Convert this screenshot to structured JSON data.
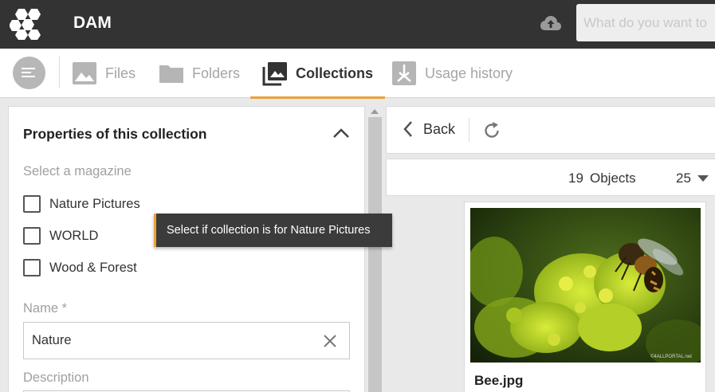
{
  "header": {
    "app_title": "DAM",
    "search_placeholder": "What do you want to"
  },
  "tabs": [
    {
      "label": "Files",
      "icon": "image-icon",
      "active": false
    },
    {
      "label": "Folders",
      "icon": "folder-icon",
      "active": false
    },
    {
      "label": "Collections",
      "icon": "collections-icon",
      "active": true
    },
    {
      "label": "Usage history",
      "icon": "usage-history-icon",
      "active": false
    }
  ],
  "properties": {
    "title": "Properties of this collection",
    "magazine_label": "Select a magazine",
    "magazines": [
      {
        "label": "Nature Pictures",
        "checked": false
      },
      {
        "label": "WORLD",
        "checked": false
      },
      {
        "label": "Wood & Forest",
        "checked": false
      }
    ],
    "name_label": "Name *",
    "name_value": "Nature",
    "description_label": "Description"
  },
  "tooltip": {
    "text": "Select if collection is for Nature Pictures"
  },
  "toolbar": {
    "back_label": "Back"
  },
  "results": {
    "count": "19",
    "count_label": "Objects",
    "page_size": "25"
  },
  "asset": {
    "name": "Bee.jpg",
    "watermark": "©4ALLPORTAL.net"
  },
  "colors": {
    "accent": "#e8a33d",
    "header_bg": "#333333"
  }
}
